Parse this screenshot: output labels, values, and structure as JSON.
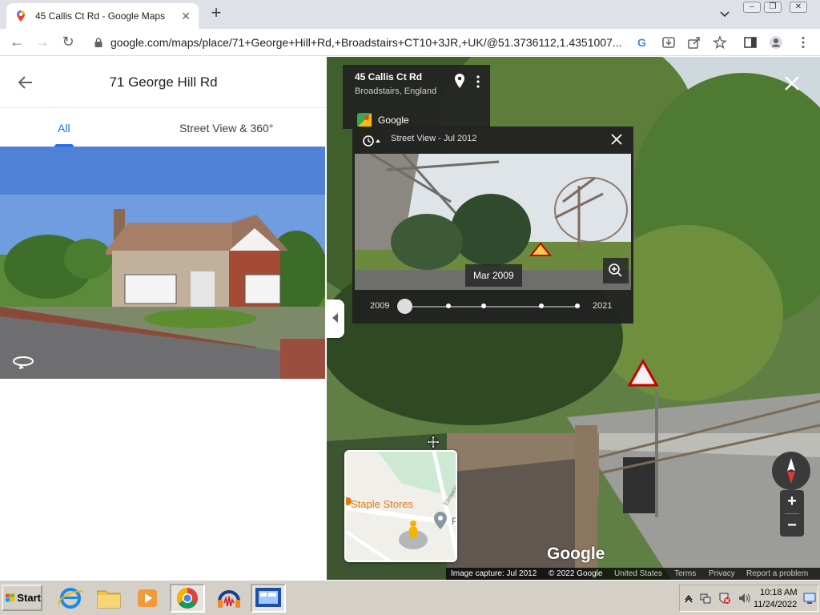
{
  "browser": {
    "tab_title": "45 Callis Ct Rd - Google Maps",
    "url": "google.com/maps/place/71+George+Hill+Rd,+Broadstairs+CT10+3JR,+UK/@51.3736112,1.4351007..."
  },
  "left_panel": {
    "title": "71 George Hill Rd",
    "tabs": [
      {
        "label": "All"
      },
      {
        "label": "Street View & 360°"
      }
    ]
  },
  "street_view": {
    "info_card": {
      "title": "45 Callis Ct Rd",
      "subtitle": "Broadstairs, England",
      "provider": "Google"
    },
    "history": {
      "label": "Street View - Jul 2012",
      "selected_date": "Mar 2009",
      "range_start": "2009",
      "range_end": "2021"
    },
    "minimap": {
      "place_label": "Staple Stores",
      "road_label": "Elmwood",
      "poi_label": "P"
    },
    "logo_text": "Google",
    "attribution": {
      "capture": "Image capture: Jul 2012",
      "copyright": "© 2022 Google",
      "country": "United States",
      "terms": "Terms",
      "privacy": "Privacy",
      "report": "Report a problem"
    }
  },
  "taskbar": {
    "start_label": "Start",
    "time": "10:18 AM",
    "date": "11/24/2022"
  },
  "colors": {
    "accent": "#1a73e8",
    "panel_dark": "#222222",
    "taskbar": "#d4d0c8"
  }
}
